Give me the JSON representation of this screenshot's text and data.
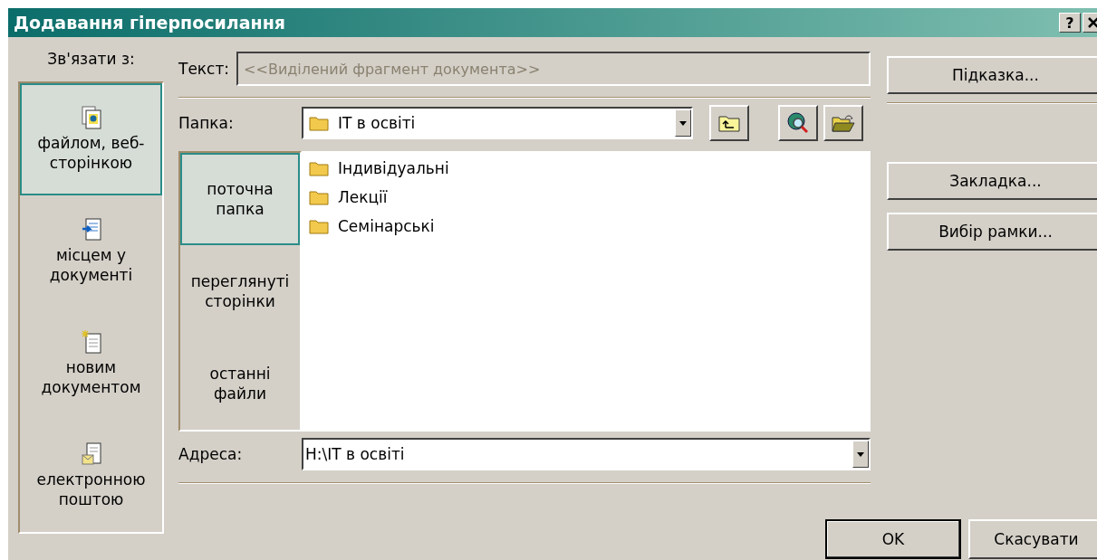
{
  "window": {
    "title": "Додавання гіперпосилання",
    "help": "?"
  },
  "link_to": {
    "label": "Зв'язати з:",
    "items": [
      {
        "label": "файлом, веб-сторінкою",
        "kind": "file",
        "selected": true
      },
      {
        "label": "місцем у документі",
        "kind": "place",
        "selected": false
      },
      {
        "label": "новим документом",
        "kind": "new",
        "selected": false
      },
      {
        "label": "електронною поштою",
        "kind": "email",
        "selected": false
      }
    ]
  },
  "text_field": {
    "label": "Текст:",
    "value": "<<Виділений фрагмент документа>>",
    "disabled": true
  },
  "folder": {
    "label": "Папка:",
    "value": "IT в освіті"
  },
  "places": [
    {
      "label": "поточна папка",
      "selected": true
    },
    {
      "label": "переглянуті сторінки",
      "selected": false
    },
    {
      "label": "останні файли",
      "selected": false
    }
  ],
  "files": [
    {
      "name": "Індивідуальні"
    },
    {
      "name": "Лекції"
    },
    {
      "name": "Семінарські"
    }
  ],
  "address": {
    "label": "Адреса:",
    "value": "H:\\IT в освіті"
  },
  "side_buttons": [
    "Підказка...",
    "Закладка...",
    "Вибір рамки..."
  ],
  "buttons": {
    "ok": "OK",
    "cancel": "Скасувати"
  }
}
